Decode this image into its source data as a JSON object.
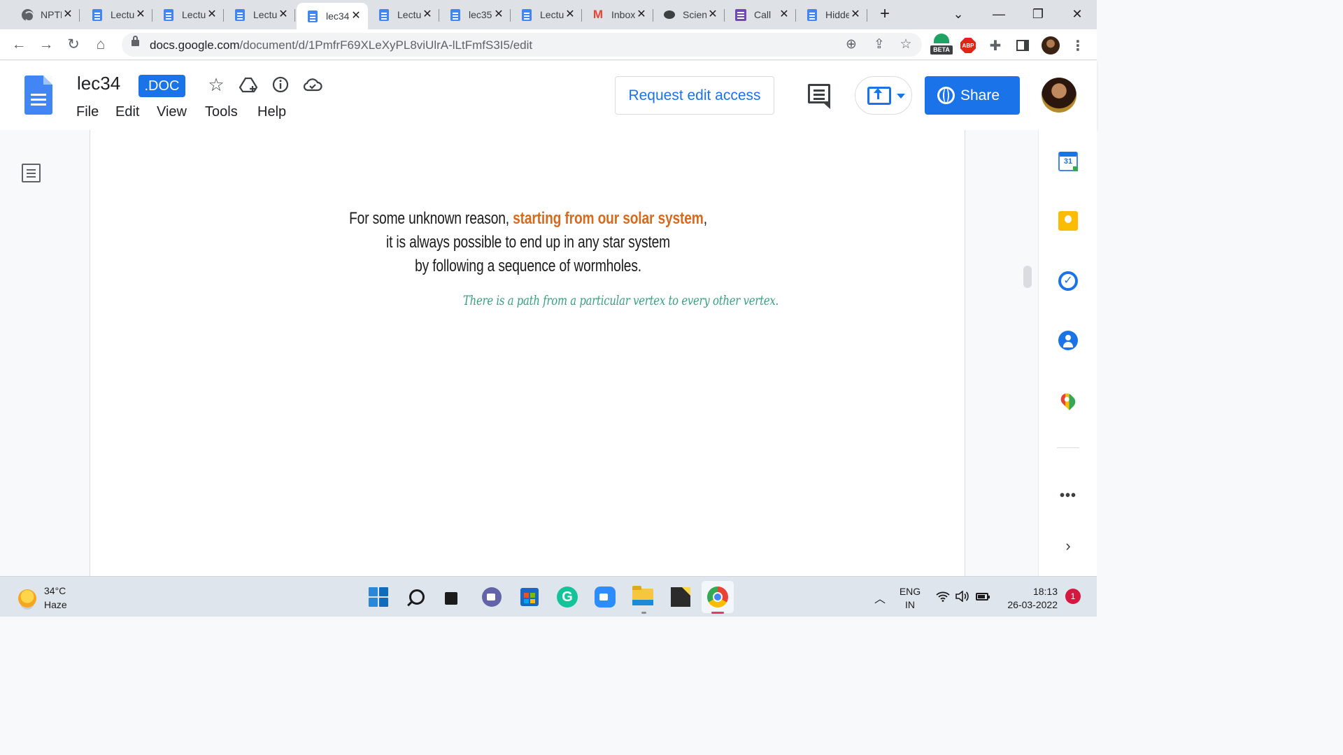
{
  "browser": {
    "tabs": [
      {
        "title": "NPTEL",
        "icon": "globe-icon"
      },
      {
        "title": "Lecture",
        "icon": "docs-icon"
      },
      {
        "title": "Lecture",
        "icon": "docs-icon"
      },
      {
        "title": "Lecture",
        "icon": "docs-icon"
      },
      {
        "title": "lec34",
        "icon": "docs-icon",
        "active": true
      },
      {
        "title": "Lecture",
        "icon": "docs-icon"
      },
      {
        "title": "lec35",
        "icon": "docs-icon"
      },
      {
        "title": "Lecture",
        "icon": "docs-icon"
      },
      {
        "title": "Inbox",
        "icon": "gmail-icon"
      },
      {
        "title": "Science",
        "icon": "chat-icon"
      },
      {
        "title": "Call",
        "icon": "forms-icon"
      },
      {
        "title": "Hidden",
        "icon": "docs-icon"
      }
    ],
    "close_glyph": "✕",
    "new_tab_glyph": "+",
    "url_host": "docs.google.com",
    "url_path": "/document/d/1PmfrF69XLeXyPL8viUlrA-lLtFmfS3I5/edit",
    "beta_label": "BETA",
    "abp_label": "ABP"
  },
  "docs": {
    "title": "lec34",
    "file_badge": ".DOC",
    "menu": [
      "File",
      "Edit",
      "View",
      "Tools",
      "Help"
    ],
    "request_edit_label": "Request edit access",
    "share_label": "Share"
  },
  "document": {
    "line1_prefix": "For some unknown reason, ",
    "line1_highlight": "starting from our solar system",
    "line1_suffix": ",",
    "line2": "it is always possible to end up in any star system",
    "line3": "by following a sequence of wormholes.",
    "handwritten_note": "There is a path from a particular vertex to every other vertex.",
    "highlight_color": "#d86a1e",
    "note_color": "#36a27c"
  },
  "side_panel": {
    "calendar_day": "31",
    "more_glyph": "•••",
    "expand_glyph": "›"
  },
  "taskbar": {
    "weather_temp": "34°C",
    "weather_desc": "Haze",
    "lang_line1": "ENG",
    "lang_line2": "IN",
    "time": "18:13",
    "date": "26-03-2022",
    "notification_count": "1"
  },
  "colors": {
    "accent": "#1a73e8",
    "tabstrip": "#dee1e6",
    "taskbar": "#dfe5ed"
  }
}
